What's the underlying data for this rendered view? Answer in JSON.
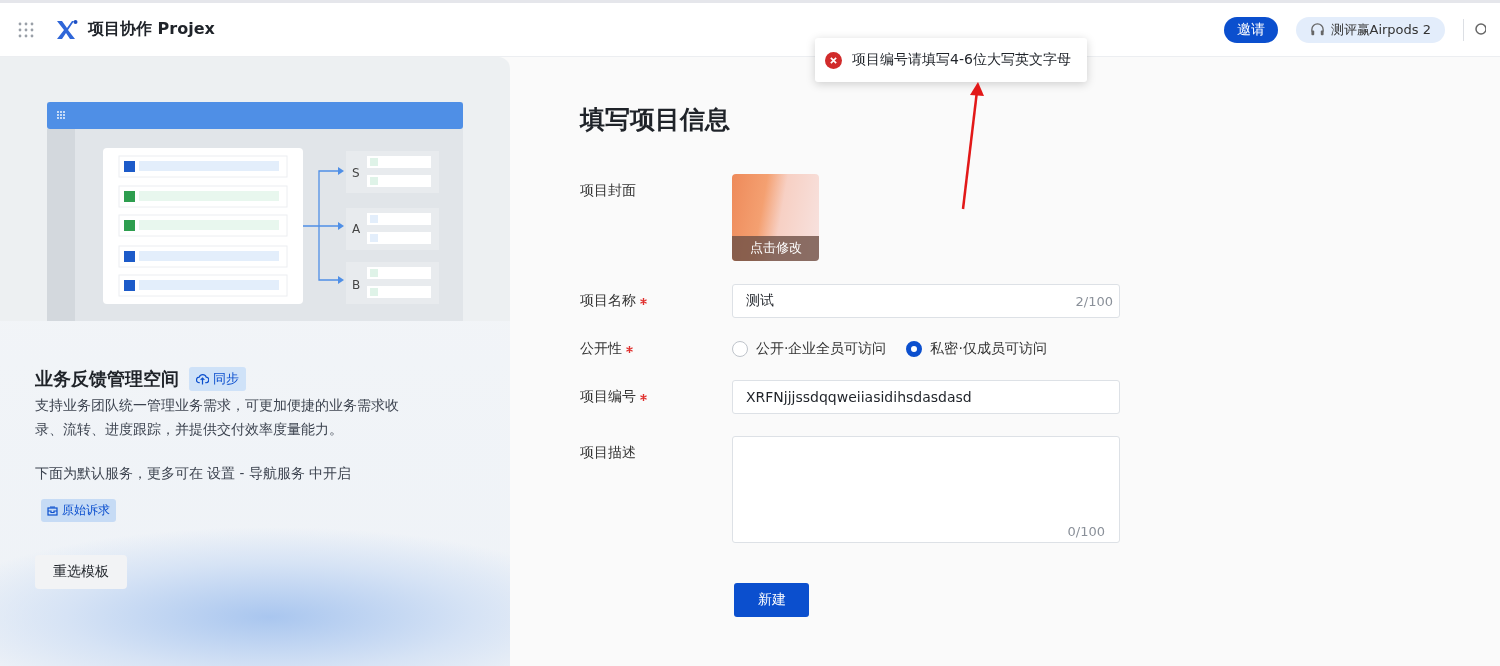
{
  "header": {
    "app_name": "项目协作 Projex",
    "invite_button": "邀请",
    "promo": "测评赢Airpods 2"
  },
  "toast": {
    "kind": "error",
    "message": "项目编号请填写4-6位大写英文字母"
  },
  "template": {
    "branches": [
      "S",
      "A",
      "B"
    ],
    "title": "业务反馈管理空间",
    "sync_badge": "同步",
    "description": "支持业务团队统一管理业务需求，可更加便捷的业务需求收录、流转、进度跟踪，并提供交付效率度量能力。",
    "services_note": "下面为默认服务，更多可在 设置 - 导航服务 中开启",
    "services": [
      {
        "label": "原始诉求"
      }
    ],
    "reselect_button": "重选模板"
  },
  "form": {
    "heading": "填写项目信息",
    "cover": {
      "label": "项目封面",
      "overlay": "点击修改"
    },
    "name": {
      "label": "项目名称",
      "required": true,
      "value": "测试",
      "counter": "2/100"
    },
    "visibility": {
      "label": "公开性",
      "required": true,
      "options": [
        {
          "label": "公开·企业全员可访问",
          "selected": false
        },
        {
          "label": "私密·仅成员可访问",
          "selected": true
        }
      ]
    },
    "code": {
      "label": "项目编号",
      "required": true,
      "value": "XRFNjjjssdqqweiiasidihsdasdasd"
    },
    "description": {
      "label": "项目描述",
      "required": false,
      "counter": "0/100"
    },
    "submit_button": "新建"
  }
}
